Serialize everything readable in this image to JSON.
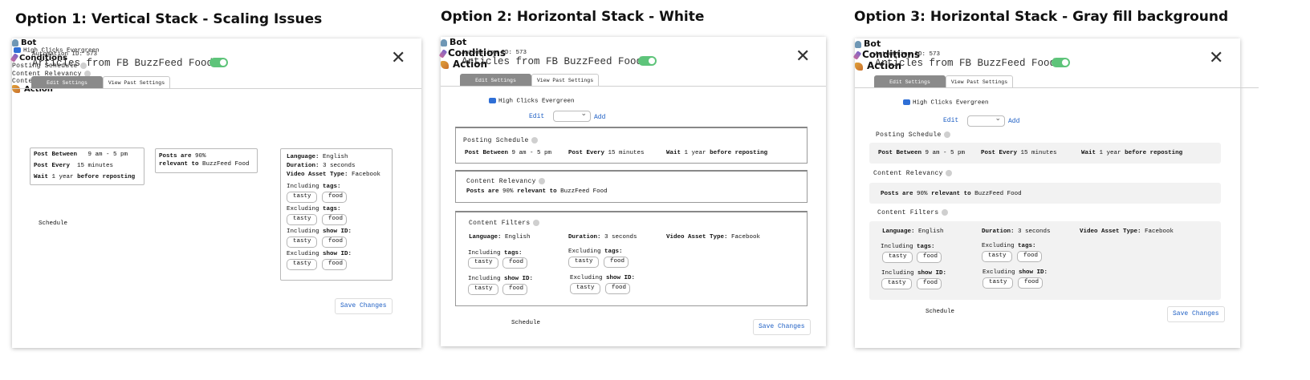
{
  "options": [
    {
      "heading": "Option 1: Vertical Stack - Scaling Issues",
      "automation_id_label": "Automation ID:",
      "automation_id": "573",
      "title": "Articles from FB BuzzFeed Food",
      "tabs": [
        "Edit Settings",
        "View Past Settings"
      ],
      "bot_title": "Bot",
      "bot_value": "High Clicks Evergreen",
      "conditions_title": "Conditions",
      "posting_title": "Posting Schedule",
      "relevancy_title": "Content Relevancy",
      "filters_title": "Content Filters",
      "post_between_label": "Post Between",
      "post_between_value": "9 am - 5 pm",
      "post_every_label": "Post Every",
      "post_every_value": "15 minutes",
      "wait_label": "Wait",
      "wait_value": "1 year",
      "wait_suffix": "before reposting",
      "posts_are_label": "Posts are",
      "posts_are_value": "90%",
      "relevant_to_label": "relevant to",
      "relevant_to_value": "BuzzFeed Food",
      "language_label": "Language:",
      "language_value": "English",
      "duration_label": "Duration:",
      "duration_value": "3 seconds",
      "video_label": "Video Asset Type:",
      "video_value": "Facebook",
      "incl_tags_label": "Including",
      "excl_tags_label": "Excluding",
      "tags_word": "tags:",
      "show_word": "show ID:",
      "chip1": "tasty",
      "chip2": "food",
      "action_title": "Action",
      "action_value": "Schedule",
      "save_label": "Save Changes"
    },
    {
      "heading": "Option 2: Horizontal Stack - White",
      "automation_id_label": "Automation ID:",
      "automation_id": "573",
      "title": "Articles from FB BuzzFeed Food",
      "tabs": [
        "Edit Settings",
        "View Past Settings"
      ],
      "bot_title": "Bot",
      "bot_value": "High Clicks Evergreen",
      "conditions_title": "Conditions",
      "edit_label": "Edit",
      "add_label": "Add",
      "posting_title": "Posting Schedule",
      "relevancy_title": "Content Relevancy",
      "filters_title": "Content Filters",
      "post_between_label": "Post Between",
      "post_between_value": "9 am - 5 pm",
      "post_every_label": "Post Every",
      "post_every_value": "15 minutes",
      "wait_label": "Wait",
      "wait_value": "1 year",
      "wait_suffix": "before reposting",
      "posts_are_label": "Posts are",
      "posts_are_value": "90%",
      "relevant_to_label": "relevant to",
      "relevant_to_value": "BuzzFeed Food",
      "language_label": "Language:",
      "language_value": "English",
      "duration_label": "Duration:",
      "duration_value": "3 seconds",
      "video_label": "Video Asset Type:",
      "video_value": "Facebook",
      "incl_tags_label": "Including",
      "excl_tags_label": "Excluding",
      "tags_word": "tags:",
      "show_word": "show ID:",
      "chip1": "tasty",
      "chip2": "food",
      "action_title": "Action",
      "action_value": "Schedule",
      "save_label": "Save Changes"
    },
    {
      "heading": "Option 3: Horizontal Stack - Gray fill background",
      "automation_id_label": "Automation ID:",
      "automation_id": "573",
      "title": "Articles from FB BuzzFeed Food",
      "tabs": [
        "Edit Settings",
        "View Past Settings"
      ],
      "bot_title": "Bot",
      "bot_value": "High Clicks Evergreen",
      "conditions_title": "Conditions",
      "edit_label": "Edit",
      "add_label": "Add",
      "posting_title": "Posting Schedule",
      "relevancy_title": "Content Relevancy",
      "filters_title": "Content Filters",
      "post_between_label": "Post Between",
      "post_between_value": "9 am - 5 pm",
      "post_every_label": "Post Every",
      "post_every_value": "15 minutes",
      "wait_label": "Wait",
      "wait_value": "1 year",
      "wait_suffix": "before reposting",
      "posts_are_label": "Posts are",
      "posts_are_value": "90%",
      "relevant_to_label": "relevant to",
      "relevant_to_value": "BuzzFeed Food",
      "language_label": "Language:",
      "language_value": "English",
      "duration_label": "Duration:",
      "duration_value": "3 seconds",
      "video_label": "Video Asset Type:",
      "video_value": "Facebook",
      "incl_tags_label": "Including",
      "excl_tags_label": "Excluding",
      "tags_word": "tags:",
      "show_word": "show ID:",
      "chip1": "tasty",
      "chip2": "food",
      "action_title": "Action",
      "action_value": "Schedule",
      "save_label": "Save Changes"
    }
  ],
  "colors": {
    "toggle_on": "#5ec47a",
    "link": "#1e5fc4",
    "active_tab": "#8a8a8a",
    "gray_fill": "#f2f2f2"
  },
  "icons": {
    "close": "close-icon",
    "info": "info-dot-icon",
    "bot": "bot-icon",
    "conditions": "conditions-icon",
    "action": "action-icon",
    "dropdown": "chevron-down-icon"
  }
}
